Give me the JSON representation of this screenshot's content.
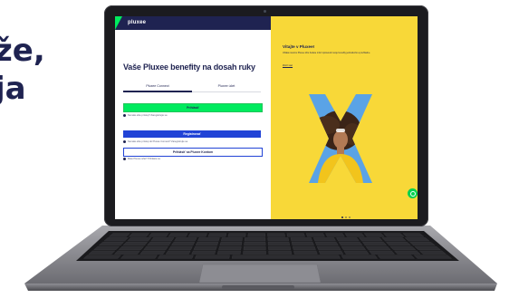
{
  "headline": {
    "line1": "že,",
    "line2": "ja"
  },
  "app": {
    "logo": "pluxee",
    "title": "Vaše Pluxee benefity na dosah ruky",
    "tabs": [
      {
        "label": "Pluxee Connect",
        "active": true
      },
      {
        "label": "Pluxee účet",
        "active": false
      }
    ],
    "buttons": {
      "primary": "Prihlásiť",
      "register": "Registrovať",
      "secondary": "Prihlásiť sa Pluxee Kontom"
    },
    "notes": [
      "Nemáte ešte prístup? Zaregistrujte sa",
      "Nemáte ešte prístup do Pluxee Connect? Zaregistrujte sa",
      "Máte Pluxee účet? Prihláste sa"
    ]
  },
  "promo": {
    "title": "Vitajte v Pluxee!",
    "text": "Vďaka novému Pluxee účtu budete môcť spravovať svoje benefity jednoducho a prehľadne.",
    "link": "Zistiť viac",
    "pages": 3,
    "active_page": 1
  },
  "colors": {
    "navy": "#1f2351",
    "green": "#00eb5e",
    "blue": "#2143d6",
    "yellow": "#f8d838",
    "sky": "#5aa3e6"
  }
}
